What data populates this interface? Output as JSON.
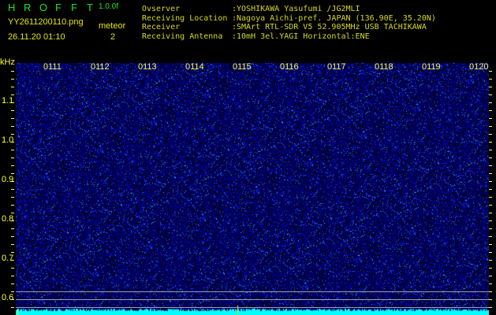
{
  "header": {
    "logo_letters": [
      "H",
      "R",
      "O",
      "F",
      "F",
      "T"
    ],
    "version": "1.0.0f",
    "filename": "YY2611200110.png",
    "datetime": "26.11.20 01:10",
    "meteor_label": "meteor",
    "meteor_count": "2"
  },
  "info": [
    {
      "label": "Ovserver",
      "value": ":YOSHIKAWA Yasufumi /JG2MLI"
    },
    {
      "label": "Receiving Location",
      "value": ":Nagoya Aichi-pref. JAPAN (136.90E, 35.20N)"
    },
    {
      "label": "Receiver",
      "value": ":SMArt RTL-SDR V5 52.905MHz USB TACHIKAWA"
    },
    {
      "label": "Receiving Antenna",
      "value": ":10mH 3el.YAGI Horizontal:ENE"
    }
  ],
  "spectrogram": {
    "y_unit": "kHz",
    "time_labels": [
      "0111",
      "0112",
      "0113",
      "0114",
      "0115",
      "0116",
      "0117",
      "0118",
      "0119",
      "0120"
    ],
    "freq_labels": [
      "1.1",
      "1.0",
      "0.9",
      "0.8",
      "0.7",
      "0.6"
    ],
    "colors": {
      "background": "#000010",
      "signal": "#1a1aff",
      "spark": "#00e0ff",
      "baseline": "#00ffff"
    }
  }
}
